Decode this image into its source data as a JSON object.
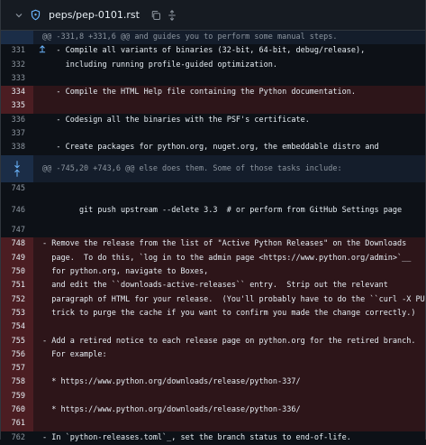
{
  "file": {
    "path": "peps/pep-0101.rst"
  },
  "hunk1": {
    "text": "@@ -331,8 +331,6 @@ and guides you to perform some manual steps."
  },
  "hunk2": {
    "text": "@@ -745,20 +743,6 @@ else does them. Some of those tasks include:"
  },
  "lines": [
    {
      "n": "331",
      "t": "   - Compile all variants of binaries (32-bit, 64-bit, debug/release),"
    },
    {
      "n": "332",
      "t": "     including running profile-guided optimization."
    },
    {
      "n": "333",
      "t": ""
    },
    {
      "n": "334",
      "t": "   - Compile the HTML Help file containing the Python documentation."
    },
    {
      "n": "335",
      "t": ""
    },
    {
      "n": "336",
      "t": "   - Codesign all the binaries with the PSF's certificate."
    },
    {
      "n": "337",
      "t": ""
    },
    {
      "n": "338",
      "t": "   - Create packages for python.org, nuget.org, the embeddable distro and"
    },
    {
      "n": "745",
      "t": ""
    },
    {
      "n": "746",
      "t": "        git push upstream --delete 3.3  # or perform from GitHub Settings page"
    },
    {
      "n": "747",
      "t": ""
    },
    {
      "n": "748",
      "t": "- Remove the release from the list of \"Active Python Releases\" on the Downloads"
    },
    {
      "n": "749",
      "t": "  page.  To do this, `log in to the admin page <https://www.python.org/admin>`__"
    },
    {
      "n": "750",
      "t": "  for python.org, navigate to Boxes,"
    },
    {
      "n": "751",
      "t": "  and edit the ``downloads-active-releases`` entry.  Strip out the relevant"
    },
    {
      "n": "752",
      "t": "  paragraph of HTML for your release.  (You'll probably have to do the ``curl -X PURGE``"
    },
    {
      "n": "753",
      "t": "  trick to purge the cache if you want to confirm you made the change correctly.)"
    },
    {
      "n": "754",
      "t": ""
    },
    {
      "n": "755",
      "t": "- Add a retired notice to each release page on python.org for the retired branch."
    },
    {
      "n": "756",
      "t": "  For example:"
    },
    {
      "n": "757",
      "t": ""
    },
    {
      "n": "758",
      "t": "  * https://www.python.org/downloads/release/python-337/"
    },
    {
      "n": "759",
      "t": ""
    },
    {
      "n": "760",
      "t": "  * https://www.python.org/downloads/release/python-336/"
    },
    {
      "n": "761",
      "t": ""
    },
    {
      "n": "762",
      "t": "- In `python-releases.toml`_, set the branch status to end-of-life."
    }
  ],
  "colors": {
    "deleted_bg": "#2d1519",
    "hunk_bg": "#141d2b",
    "accent": "#6cb6ff"
  }
}
